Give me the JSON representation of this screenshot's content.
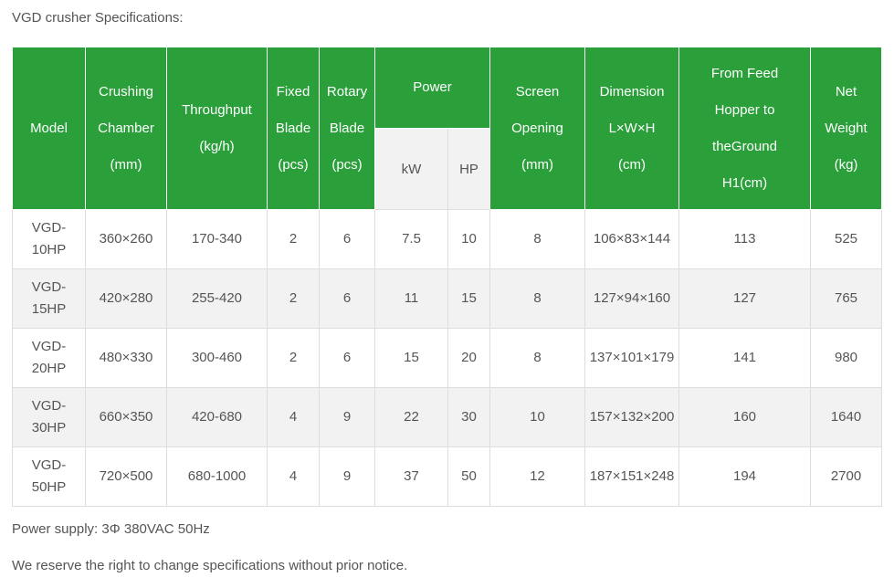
{
  "caption": "VGD crusher Specifications:",
  "table": {
    "headers": {
      "model": [
        "Model"
      ],
      "crushing_chamber": [
        "Crushing",
        "Chamber",
        "(mm)"
      ],
      "throughput": [
        "Throughput",
        "(kg/h)"
      ],
      "fixed_blade": [
        "Fixed",
        "Blade",
        "(pcs)"
      ],
      "rotary_blade": [
        "Rotary",
        "Blade",
        "(pcs)"
      ],
      "power": [
        "Power"
      ],
      "power_kw": "kW",
      "power_hp": "HP",
      "screen_opening": [
        "Screen",
        "Opening",
        "(mm)"
      ],
      "dimension": [
        "Dimension",
        "L×W×H",
        "(cm)"
      ],
      "from_feed_hopper": [
        "From Feed",
        "Hopper to",
        "theGround",
        "H1(cm)"
      ],
      "net_weight": [
        "Net",
        "Weight",
        "(kg)"
      ]
    },
    "rows": [
      {
        "model": [
          "VGD-",
          "10HP"
        ],
        "chamber": "360×260",
        "throughput": "170-340",
        "fixed": "2",
        "rotary": "6",
        "kw": "7.5",
        "hp": "10",
        "screen": "8",
        "dimension": "106×83×144",
        "hopper": "113",
        "weight": "525"
      },
      {
        "model": [
          "VGD-",
          "15HP"
        ],
        "chamber": "420×280",
        "throughput": "255-420",
        "fixed": "2",
        "rotary": "6",
        "kw": "11",
        "hp": "15",
        "screen": "8",
        "dimension": "127×94×160",
        "hopper": "127",
        "weight": "765"
      },
      {
        "model": [
          "VGD-",
          "20HP"
        ],
        "chamber": "480×330",
        "throughput": "300-460",
        "fixed": "2",
        "rotary": "6",
        "kw": "15",
        "hp": "20",
        "screen": "8",
        "dimension": "137×101×179",
        "hopper": "141",
        "weight": "980"
      },
      {
        "model": [
          "VGD-",
          "30HP"
        ],
        "chamber": "660×350",
        "throughput": "420-680",
        "fixed": "4",
        "rotary": "9",
        "kw": "22",
        "hp": "30",
        "screen": "10",
        "dimension": "157×132×200",
        "hopper": "160",
        "weight": "1640"
      },
      {
        "model": [
          "VGD-",
          "50HP"
        ],
        "chamber": "720×500",
        "throughput": "680-1000",
        "fixed": "4",
        "rotary": "9",
        "kw": "37",
        "hp": "50",
        "screen": "12",
        "dimension": "187×151×248",
        "hopper": "194",
        "weight": "2700"
      }
    ]
  },
  "notes": {
    "power_supply": "Power supply: 3Φ 380VAC 50Hz",
    "disclaimer": "We reserve the right to change specifications without prior notice."
  },
  "colors": {
    "header_green": "#2a9f3a",
    "alt_row": "#f2f2f2",
    "text": "#555555"
  }
}
